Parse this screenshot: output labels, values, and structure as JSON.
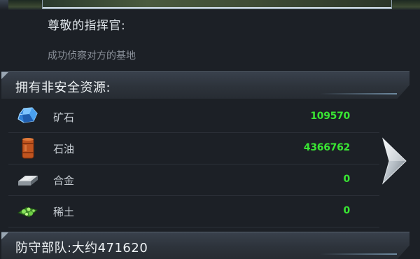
{
  "greeting": "尊敬的指挥官:",
  "message": "成功侦察对方的基地",
  "resources_header": "拥有非安全资源:",
  "resources": [
    {
      "icon": "ore-crystal-icon",
      "name": "矿石",
      "value": "109570"
    },
    {
      "icon": "oil-barrel-icon",
      "name": "石油",
      "value": "4366762"
    },
    {
      "icon": "alloy-bar-icon",
      "name": "合金",
      "value": "0"
    },
    {
      "icon": "rare-earth-icon",
      "name": "稀土",
      "value": "0"
    }
  ],
  "defense_label": "防守部队:大约471620",
  "colors": {
    "value_green": "#39e633",
    "panel_bg": "#1c2026"
  },
  "next_icon": "chevron-right-icon"
}
